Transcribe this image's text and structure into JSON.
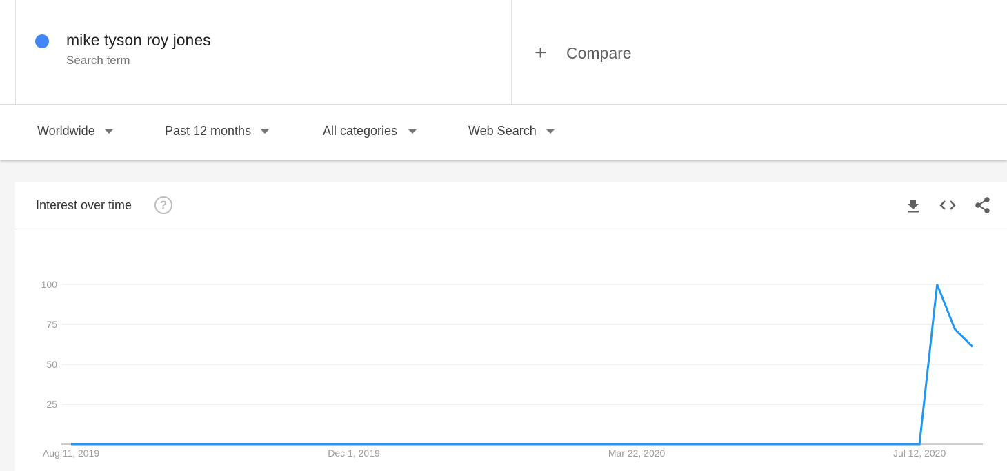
{
  "search_term": {
    "label": "mike tyson roy jones",
    "type": "Search term",
    "color": "#4285f4"
  },
  "compare": {
    "icon": "plus-icon",
    "label": "Compare"
  },
  "filters": [
    {
      "label": "Worldwide"
    },
    {
      "label": "Past 12 months"
    },
    {
      "label": "All categories"
    },
    {
      "label": "Web Search"
    }
  ],
  "card": {
    "title": "Interest over time",
    "help_icon": "?",
    "actions": [
      "download-icon",
      "embed-icon",
      "share-icon"
    ]
  },
  "chart_data": {
    "type": "line",
    "title": "Interest over time",
    "xlabel": "",
    "ylabel": "",
    "ylim": [
      0,
      100
    ],
    "yticks": [
      25,
      50,
      75,
      100
    ],
    "grid": true,
    "line_color": "#2196f3",
    "x_tick_labels": [
      {
        "index": 0,
        "label": "Aug 11, 2019"
      },
      {
        "index": 16,
        "label": "Dec 1, 2019"
      },
      {
        "index": 32,
        "label": "Mar 22, 2020"
      },
      {
        "index": 48,
        "label": "Jul 12, 2020"
      }
    ],
    "series": [
      {
        "name": "mike tyson roy jones",
        "values": [
          0,
          0,
          0,
          0,
          0,
          0,
          0,
          0,
          0,
          0,
          0,
          0,
          0,
          0,
          0,
          0,
          0,
          0,
          0,
          0,
          0,
          0,
          0,
          0,
          0,
          0,
          0,
          0,
          0,
          0,
          0,
          0,
          0,
          0,
          0,
          0,
          0,
          0,
          0,
          0,
          0,
          0,
          0,
          0,
          0,
          0,
          0,
          0,
          0,
          100,
          72,
          61
        ]
      }
    ]
  }
}
